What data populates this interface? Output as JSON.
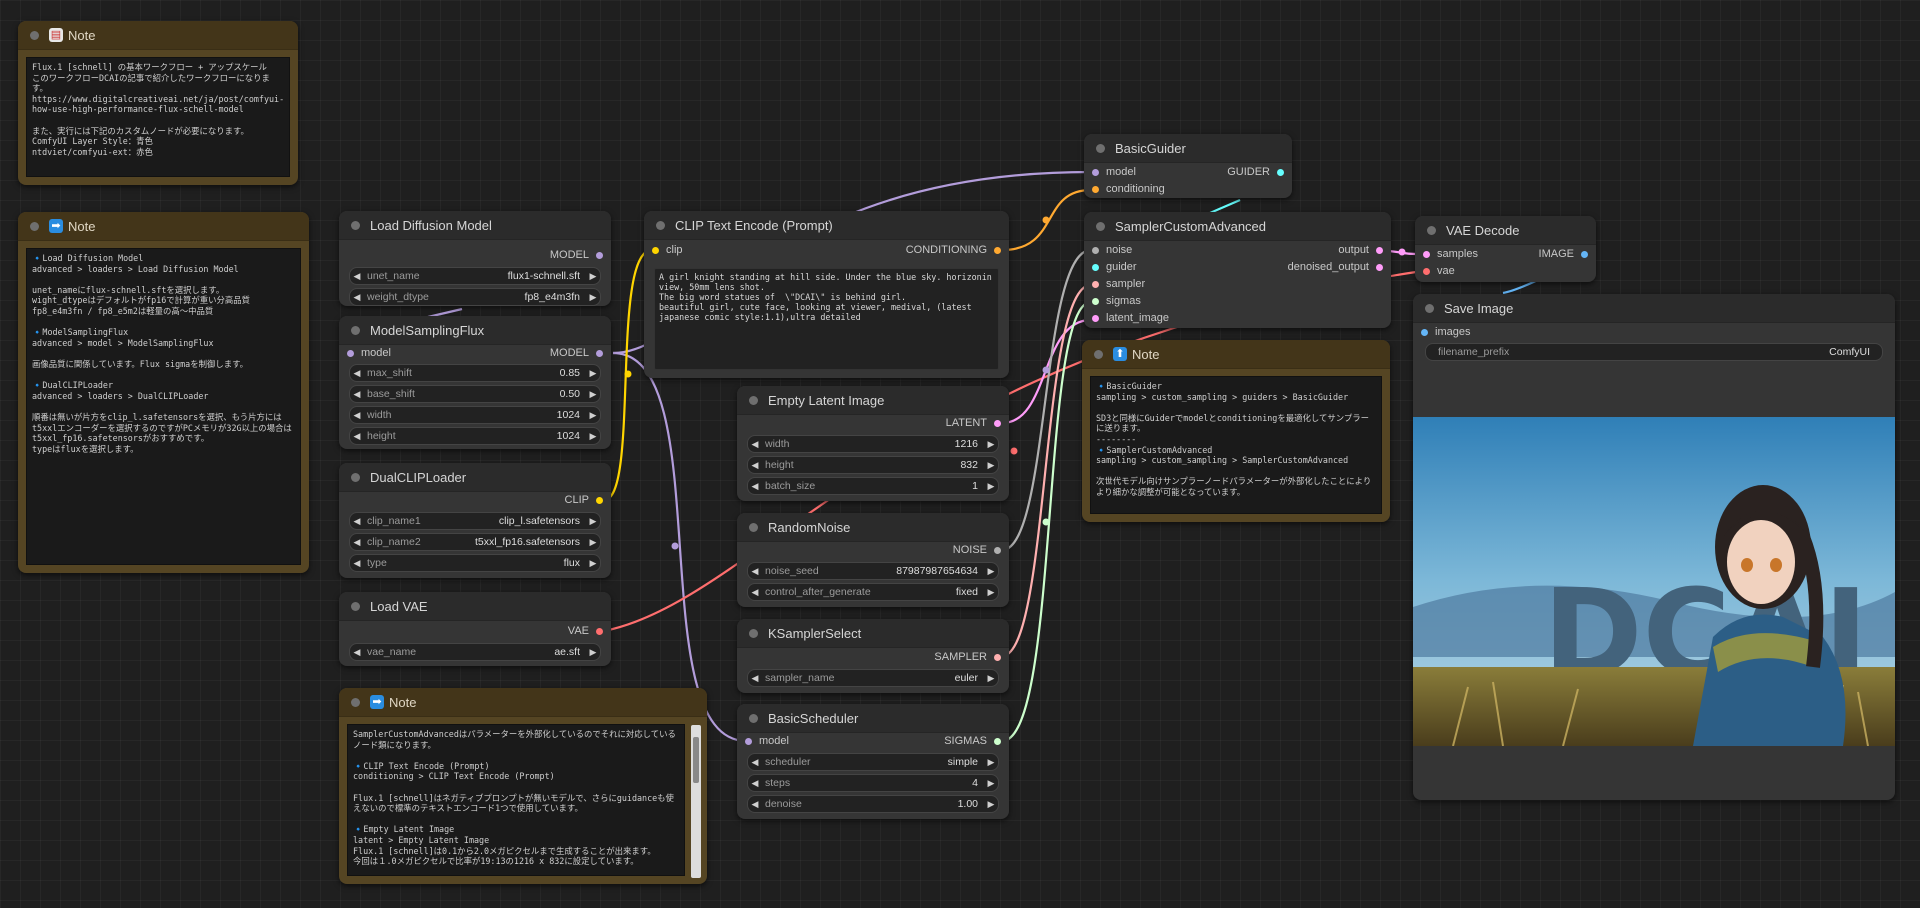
{
  "colors": {
    "model": "#b39ddb",
    "clip": "#ffd500",
    "conditioning": "#ffa931",
    "latent": "#ff9cf9",
    "vae": "#ff6e6e",
    "image": "#64b5f6",
    "noise": "#b0b0b0",
    "guider": "#66ffff",
    "sampler": "#ffb0b0",
    "sigmas": "#cdffcd"
  },
  "notes": {
    "note1": {
      "title": "Note",
      "icon": "document-icon",
      "body": "Flux.1 [schnell] の基本ワークフロー + アップスケール\nこのワークフローDCAIの記事で紹介したワークフローになります。\nhttps://www.digitalcreativeai.net/ja/post/comfyui-how-use-high-performance-flux-schell-model\n\nまた、実行には下記のカスタムノードが必要になります。\nComfyUI Layer Style：青色\nntdviet/comfyui-ext：赤色"
    },
    "note2": {
      "title": "Note",
      "icon": "right-arrow-icon",
      "body": "🔹Load Diffusion Model\nadvanced > loaders > Load Diffusion Model\n\nunet_nameにflux-schnell.sftを選択します。\nwight_dtypeはデフォルトがfp16で計算が重い分高品質\nfp8_e4m3fn / fp8_e5m2は軽量の高〜中品質\n\n🔹ModelSamplingFlux\nadvanced > model > ModelSamplingFlux\n\n画像品質に関係しています。Flux sigmaを制御します。\n\n🔹DualCLIPLoader\nadvanced > loaders > DualCLIPLoader\n\n順番は無いが片方をclip_l.safetensorsを選択、もう片方にはt5xxlエンコーダーを選択するのですがPCメモリが32G以上の場合はt5xxl_fp16.safetensorsがおすすめです。\ntypeはfluxを選択します。"
    },
    "note3": {
      "title": "Note",
      "icon": "right-arrow-icon",
      "body": "SamplerCustomAdvancedはパラメーターを外部化しているのでそれに対応しているノード類になります。\n\n🔹CLIP Text Encode (Prompt)\nconditioning > CLIP Text Encode (Prompt)\n\nFlux.1 [schnell]はネガティブプロンプトが無いモデルで、さらにguidanceも使えないので標準のテキストエンコード1つで使用しています。\n\n🔹Empty Latent Image\nlatent > Empty Latent Image\nFlux.1 [schnell]は0.1から2.0メガピクセルまで生成することが出来ます。\n今回は１.0メガピクセルで比率が19:13の1216 x 832に設定しています。"
    },
    "note4": {
      "title": "Note",
      "icon": "up-arrow-icon",
      "body": "🔹BasicGuider\nsampling > custom_sampling > guiders > BasicGuider\n\nSD3と同様にGuiderでmodelとconditioningを最適化してサンプラーに送ります。\n--------\n🔹SamplerCustomAdvanced\nsampling > custom_sampling > SamplerCustomAdvanced\n\n次世代モデル向けサンプラーノードパラメーターが外部化したことによりより細かな調整が可能となっています。"
    }
  },
  "load_diffusion": {
    "title": "Load Diffusion Model",
    "out": "MODEL",
    "w": [
      {
        "l": "unet_name",
        "v": "flux1-schnell.sft"
      },
      {
        "l": "weight_dtype",
        "v": "fp8_e4m3fn"
      }
    ]
  },
  "model_sampling": {
    "title": "ModelSamplingFlux",
    "in": "model",
    "out": "MODEL",
    "w": [
      {
        "l": "max_shift",
        "v": "0.85"
      },
      {
        "l": "base_shift",
        "v": "0.50"
      },
      {
        "l": "width",
        "v": "1024"
      },
      {
        "l": "height",
        "v": "1024"
      }
    ]
  },
  "dual_clip": {
    "title": "DualCLIPLoader",
    "out": "CLIP",
    "w": [
      {
        "l": "clip_name1",
        "v": "clip_l.safetensors"
      },
      {
        "l": "clip_name2",
        "v": "t5xxl_fp16.safetensors"
      },
      {
        "l": "type",
        "v": "flux"
      }
    ]
  },
  "load_vae": {
    "title": "Load VAE",
    "out": "VAE",
    "w": [
      {
        "l": "vae_name",
        "v": "ae.sft"
      }
    ]
  },
  "clip_text": {
    "title": "CLIP Text Encode (Prompt)",
    "in": "clip",
    "out": "CONDITIONING",
    "text": "A girl knight standing at hill side. Under the blue sky. horizonin view, 50mm lens shot.\nThe big word statues of  \\\"DCAI\\\" is behind girl.\nbeautiful girl, cute face, looking at viewer, medival, (latest japanese comic style:1.1),ultra detailed"
  },
  "empty_latent": {
    "title": "Empty Latent Image",
    "out": "LATENT",
    "w": [
      {
        "l": "width",
        "v": "1216"
      },
      {
        "l": "height",
        "v": "832"
      },
      {
        "l": "batch_size",
        "v": "1"
      }
    ]
  },
  "random_noise": {
    "title": "RandomNoise",
    "out": "NOISE",
    "w": [
      {
        "l": "noise_seed",
        "v": "87987987654634"
      },
      {
        "l": "control_after_generate",
        "v": "fixed"
      }
    ]
  },
  "ksampler_select": {
    "title": "KSamplerSelect",
    "out": "SAMPLER",
    "w": [
      {
        "l": "sampler_name",
        "v": "euler"
      }
    ]
  },
  "basic_scheduler": {
    "title": "BasicScheduler",
    "in": "model",
    "out": "SIGMAS",
    "w": [
      {
        "l": "scheduler",
        "v": "simple"
      },
      {
        "l": "steps",
        "v": "4"
      },
      {
        "l": "denoise",
        "v": "1.00"
      }
    ]
  },
  "basic_guider": {
    "title": "BasicGuider",
    "in": [
      "model",
      "conditioning"
    ],
    "out": "GUIDER"
  },
  "sampler_adv": {
    "title": "SamplerCustomAdvanced",
    "in": [
      "noise",
      "guider",
      "sampler",
      "sigmas",
      "latent_image"
    ],
    "out": [
      "output",
      "denoised_output"
    ]
  },
  "vae_decode": {
    "title": "VAE Decode",
    "in": [
      "samples",
      "vae"
    ],
    "out": "IMAGE"
  },
  "save_image": {
    "title": "Save Image",
    "in": "images",
    "w": [
      {
        "l": "filename_prefix",
        "v": "ComfyUI"
      }
    ],
    "preview_text": "DCAI"
  }
}
